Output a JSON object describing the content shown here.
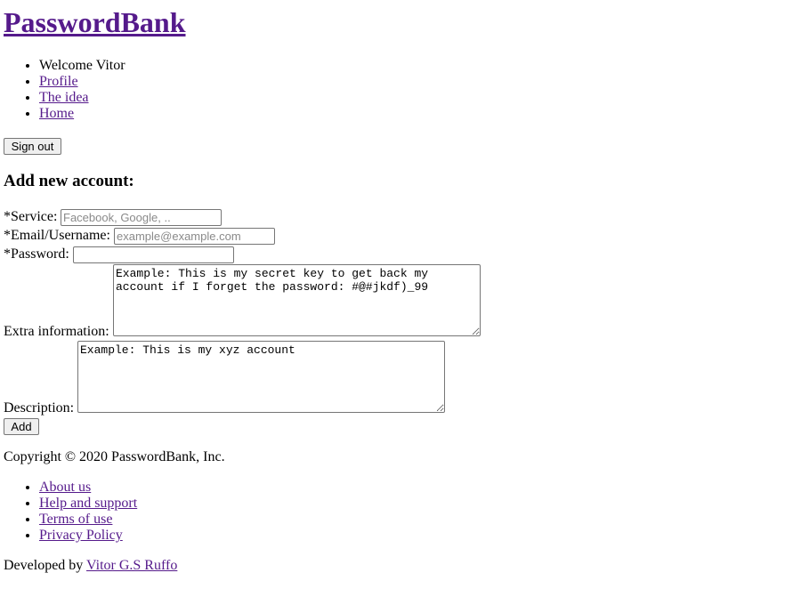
{
  "brand": {
    "title": "PasswordBank"
  },
  "nav": {
    "welcome": "Welcome Vitor",
    "items": [
      "Profile",
      "The idea",
      "Home"
    ]
  },
  "signout_label": "Sign out",
  "form": {
    "title": "Add new account:",
    "service_label": "*Service:",
    "service_placeholder": "Facebook, Google, ..",
    "email_label": "*Email/Username:",
    "email_placeholder": "example@example.com",
    "password_label": "*Password:",
    "password_value": "",
    "extra_label": "Extra information:",
    "extra_placeholder": "Example: This is my secret key to get back my account if I forget the password: #@#jkdf)_99",
    "description_label": "Description:",
    "description_placeholder": "Example: This is my xyz account",
    "add_label": "Add"
  },
  "footer": {
    "copyright": "Copyright © 2020 PasswordBank, Inc.",
    "links": [
      "About us",
      "Help and support",
      "Terms of use",
      "Privacy Policy"
    ],
    "developed_by": "Developed by",
    "developer": "Vitor G.S Ruffo"
  },
  "colors": {
    "link": "#551a8b",
    "button_bg": "#efefef",
    "border": "#767676"
  }
}
